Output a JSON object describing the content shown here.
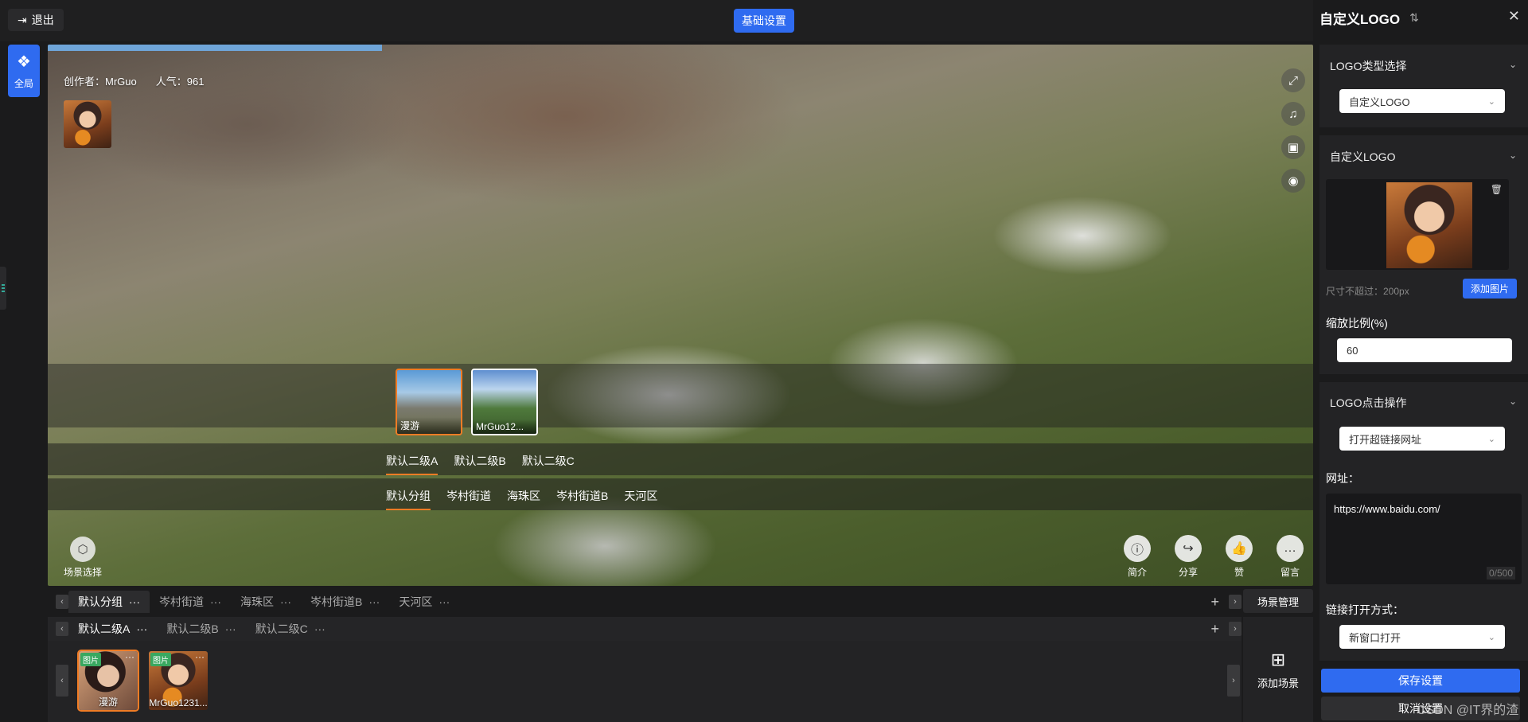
{
  "topbar": {
    "exit_label": "退出",
    "basic_settings_label": "基础设置",
    "global_label": "全局"
  },
  "viewer": {
    "author": "创作者：MrGuo",
    "popularity": "人气：961",
    "thumbs": [
      {
        "label": "漫游",
        "active": true
      },
      {
        "label": "MrGuo12...",
        "active": false
      }
    ],
    "sub_tabs": [
      "默认二级A",
      "默认二级B",
      "默认二级C"
    ],
    "group_tabs": [
      "默认分组",
      "岑村街道",
      "海珠区",
      "岑村街道B",
      "天河区"
    ],
    "scene_select_label": "场景选择",
    "actions": [
      {
        "icon": "info-icon",
        "label": "简介"
      },
      {
        "icon": "share-icon",
        "label": "分享"
      },
      {
        "icon": "like-icon",
        "label": "赞"
      },
      {
        "icon": "comment-icon",
        "label": "留言"
      }
    ]
  },
  "manager": {
    "group_tabs": [
      "默认分组",
      "岑村街道",
      "海珠区",
      "岑村街道B",
      "天河区"
    ],
    "sub_tabs": [
      "默认二级A",
      "默认二级B",
      "默认二级C"
    ],
    "scenes": [
      {
        "badge": "图片",
        "label": "漫游"
      },
      {
        "badge": "图片",
        "label": "MrGuo1231..."
      }
    ],
    "scene_manage_label": "场景管理",
    "add_scene_label": "添加场景",
    "more": "···"
  },
  "panel": {
    "title": "自定义LOGO",
    "type_section_title": "LOGO类型选择",
    "type_value": "自定义LOGO",
    "logo_section_title": "自定义LOGO",
    "size_hint": "尺寸不超过：200px",
    "add_image_label": "添加图片",
    "scale_label": "缩放比例(%)",
    "scale_value": "60",
    "click_section_title": "LOGO点击操作",
    "click_value": "打开超链接网址",
    "url_label": "网址：",
    "url_value": "https://www.baidu.com/",
    "url_counter": "0/500",
    "open_mode_label": "链接打开方式：",
    "open_mode_value": "新窗口打开",
    "save_label": "保存设置",
    "cancel_label": "取消设置",
    "watermark": "CSDN @IT界的渣"
  }
}
